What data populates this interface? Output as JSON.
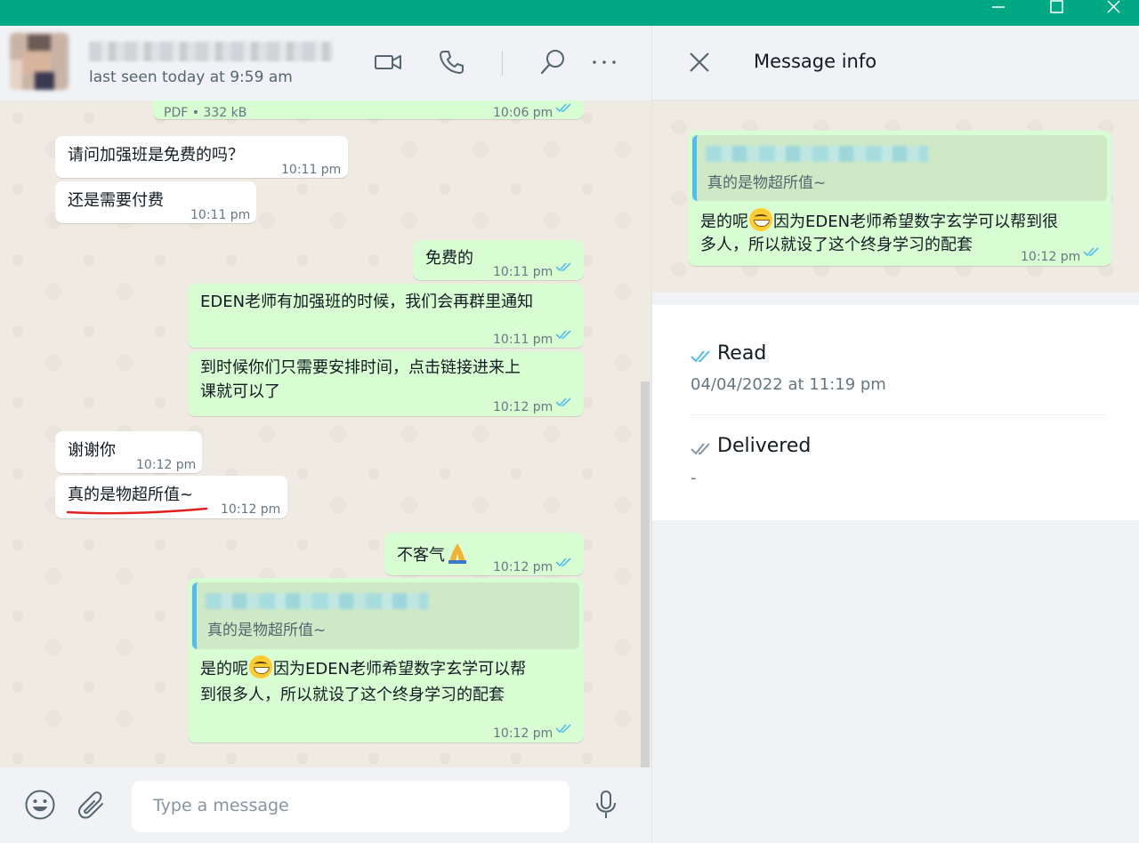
{
  "contact": {
    "last_seen": "last seen today at 9:59 am"
  },
  "header_icons": [
    "video-call-icon",
    "voice-call-icon",
    "search-icon",
    "menu-icon"
  ],
  "messages": {
    "attachment": {
      "meta": "PDF • 332 kB",
      "time": "10:06 pm"
    },
    "m1": {
      "text": "请问加强班是免费的吗？",
      "time": "10:11 pm"
    },
    "m2": {
      "text": "还是需要付费",
      "time": "10:11 pm"
    },
    "m3": {
      "text": "免费的",
      "time": "10:11 pm"
    },
    "m4": {
      "text": "EDEN老师有加强班的时候，我们会再群里通知",
      "time": "10:11 pm"
    },
    "m5": {
      "line1": "到时候你们只需要安排时间，点击链接进来上",
      "line2": "课就可以了",
      "time": "10:12 pm"
    },
    "m6": {
      "text": "谢谢你",
      "time": "10:12 pm"
    },
    "m7": {
      "text": "真的是物超所值~",
      "time": "10:12 pm"
    },
    "m8": {
      "text": "不客气",
      "time": "10:12 pm"
    },
    "m9": {
      "quote_text": "真的是物超所值~",
      "line1_a": "是的呢",
      "line1_b": "因为EDEN老师希望数字玄学可以帮",
      "line2": "到很多人，所以就设了这个终身学习的配套",
      "time": "10:12 pm"
    }
  },
  "composer": {
    "placeholder": "Type a message"
  },
  "info_panel": {
    "title": "Message info",
    "preview": {
      "quote_text": "真的是物超所值~",
      "line1_a": "是的呢",
      "line1_b": "因为EDEN老师希望数字玄学可以帮到很",
      "line2": "多人，所以就设了这个终身学习的配套",
      "time": "10:12 pm"
    },
    "read": {
      "label": "Read",
      "value": "04/04/2022 at 11:19 pm"
    },
    "delivered": {
      "label": "Delivered",
      "value": "-"
    }
  },
  "colors": {
    "titlebar": "#00a884",
    "outgoing_bubble": "#d9fdd3",
    "incoming_bubble": "#ffffff",
    "read_tick": "#53bdeb",
    "underline_annotation": "#e02020"
  }
}
